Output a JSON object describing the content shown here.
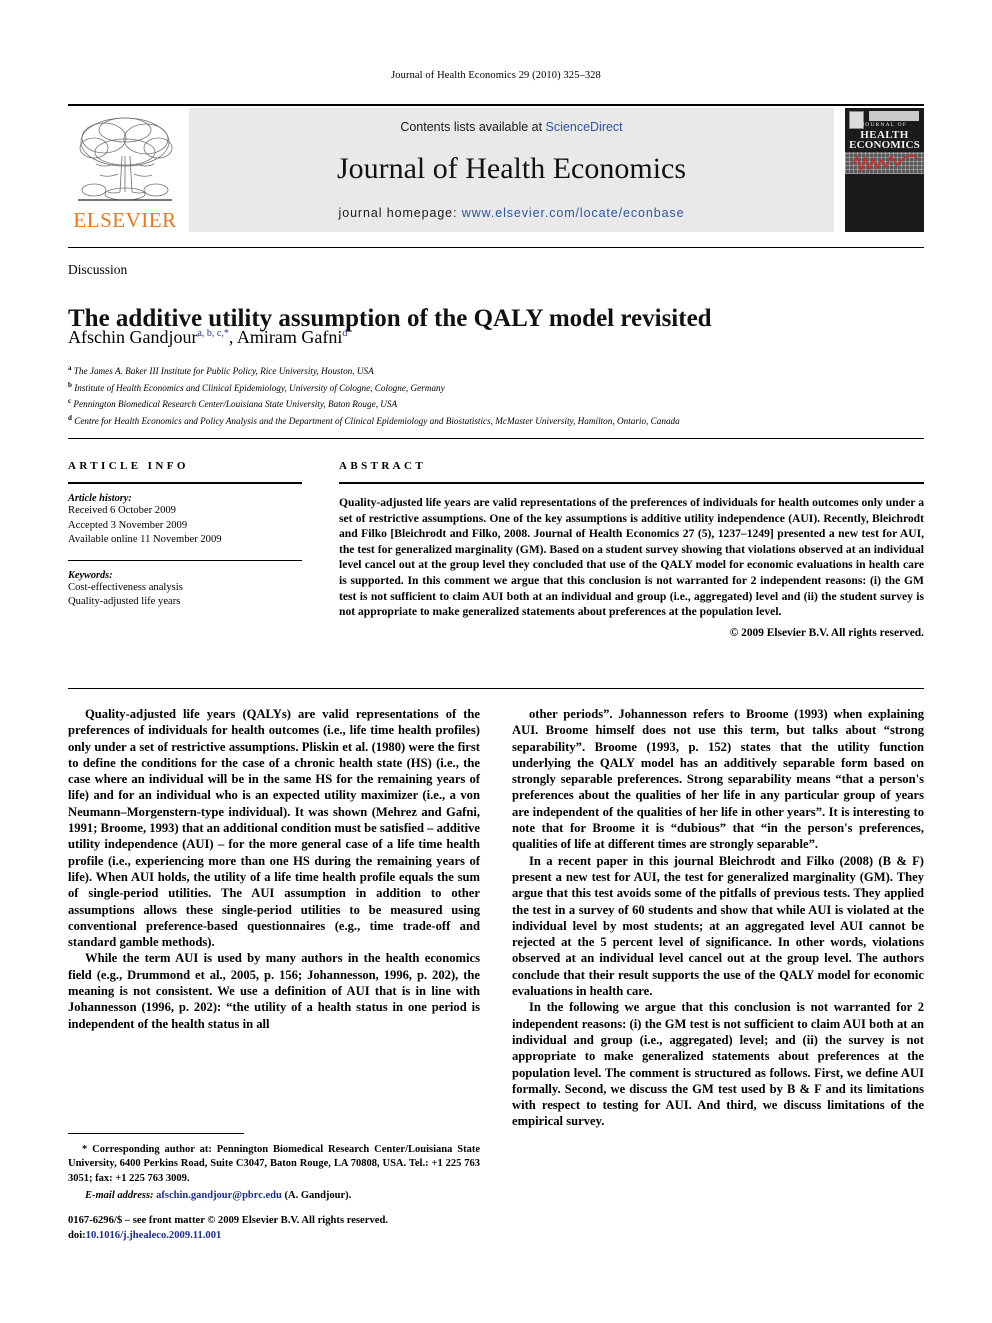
{
  "running_head": "Journal of Health Economics 29 (2010) 325–328",
  "masthead": {
    "contents_prefix": "Contents lists available at ",
    "sciencedirect": "ScienceDirect",
    "journal_title": "Journal of Health Economics",
    "homepage_prefix": "journal homepage: ",
    "homepage_url": "www.elsevier.com/locate/econbase",
    "publisher": "ELSEVIER",
    "cover": {
      "line1": "JOURNAL OF",
      "line2": "HEALTH",
      "line3": "ECONOMICS"
    },
    "link_color": "#2b55a5",
    "band_color": "#e9e9e9",
    "elsevier_orange": "#E87722"
  },
  "article": {
    "section_type": "Discussion",
    "title": "The additive utility assumption of the QALY model revisited",
    "author_1": "Afschin Gandjour",
    "author_1_sup": "a, b, c,",
    "author_1_star": "*",
    "author_2": ", Amiram Gafni",
    "author_2_sup": "d",
    "affiliations": [
      {
        "mark": "a",
        "text": "The James A. Baker III Institute for Public Policy, Rice University, Houston, USA"
      },
      {
        "mark": "b",
        "text": "Institute of Health Economics and Clinical Epidemiology, University of Cologne, Cologne, Germany"
      },
      {
        "mark": "c",
        "text": "Pennington Biomedical Research Center/Louisiana State University, Baton Rouge, USA"
      },
      {
        "mark": "d",
        "text": "Centre for Health Economics and Policy Analysis and the Department of Clinical Epidemiology and Biostatistics, McMaster University, Hamilton, Ontario, Canada"
      }
    ]
  },
  "article_info": {
    "heading": "ARTICLE INFO",
    "history_label": "Article history:",
    "history": [
      "Received 6 October 2009",
      "Accepted 3 November 2009",
      "Available online 11 November 2009"
    ],
    "keywords_label": "Keywords:",
    "keywords": [
      "Cost-effectiveness analysis",
      "Quality-adjusted life years"
    ]
  },
  "abstract": {
    "heading": "ABSTRACT",
    "text": "Quality-adjusted life years are valid representations of the preferences of individuals for health outcomes only under a set of restrictive assumptions. One of the key assumptions is additive utility independence (AUI). Recently, Bleichrodt and Filko [Bleichrodt and Filko, 2008. Journal of Health Economics 27 (5), 1237–1249] presented a new test for AUI, the test for generalized marginality (GM). Based on a student survey showing that violations observed at an individual level cancel out at the group level they concluded that use of the QALY model for economic evaluations in health care is supported. In this comment we argue that this conclusion is not warranted for 2 independent reasons: (i) the GM test is not sufficient to claim AUI both at an individual and group (i.e., aggregated) level and (ii) the student survey is not appropriate to make generalized statements about preferences at the population level.",
    "copyright": "© 2009 Elsevier B.V. All rights reserved."
  },
  "body": {
    "left": [
      "Quality-adjusted life years (QALYs) are valid representations of the preferences of individuals for health outcomes (i.e., life time health profiles) only under a set of restrictive assumptions. Pliskin et al. (1980) were the first to define the conditions for the case of a chronic health state (HS) (i.e., the case where an individual will be in the same HS for the remaining years of life) and for an individual who is an expected utility maximizer (i.e., a von Neumann–Morgenstern-type individual). It was shown (Mehrez and Gafni, 1991; Broome, 1993) that an additional condition must be satisfied – additive utility independence (AUI) – for the more general case of a life time health profile (i.e., experiencing more than one HS during the remaining years of life). When AUI holds, the utility of a life time health profile equals the sum of single-period utilities. The AUI assumption in addition to other assumptions allows these single-period utilities to be measured using conventional preference-based questionnaires (e.g., time trade-off and standard gamble methods).",
      "While the term AUI is used by many authors in the health economics field (e.g., Drummond et al., 2005, p. 156; Johannesson, 1996, p. 202), the meaning is not consistent. We use a definition of AUI that is in line with Johannesson (1996, p. 202): “the utility of a health status in one period is independent of the health status in all"
    ],
    "right": [
      "other periods”. Johannesson refers to Broome (1993) when explaining AUI. Broome himself does not use this term, but talks about “strong separability”. Broome (1993, p. 152) states that the utility function underlying the QALY model has an additively separable form based on strongly separable preferences. Strong separability means “that a person's preferences about the qualities of her life in any particular group of years are independent of the qualities of her life in other years”. It is interesting to note that for Broome it is “dubious” that “in the person's preferences, qualities of life at different times are strongly separable”.",
      "In a recent paper in this journal Bleichrodt and Filko (2008) (B & F) present a new test for AUI, the test for generalized marginality (GM). They argue that this test avoids some of the pitfalls of previous tests. They applied the test in a survey of 60 students and show that while AUI is violated at the individual level by most students; at an aggregated level AUI cannot be rejected at the 5 percent level of significance. In other words, violations observed at an individual level cancel out at the group level. The authors conclude that their result supports the use of the QALY model for economic evaluations in health care.",
      "In the following we argue that this conclusion is not warranted for 2 independent reasons: (i) the GM test is not sufficient to claim AUI both at an individual and group (i.e., aggregated) level; and (ii) the survey is not appropriate to make generalized statements about preferences at the population level. The comment is structured as follows. First, we define AUI formally. Second, we discuss the GM test used by B & F and its limitations with respect to testing for AUI. And third, we discuss limitations of the empirical survey."
    ]
  },
  "footnotes": {
    "corresponding": "* Corresponding author at: Pennington Biomedical Research Center/Louisiana State University, 6400 Perkins Road, Suite C3047, Baton Rouge, LA 70808, USA. Tel.: +1 225 763 3051; fax: +1 225 763 3009.",
    "email_label": "E-mail address:",
    "email": "afschin.gandjour@pbrc.edu",
    "email_suffix": " (A. Gandjour)."
  },
  "imprint": {
    "line1": "0167-6296/$ – see front matter © 2009 Elsevier B.V. All rights reserved.",
    "doi_label": "doi:",
    "doi": "10.1016/j.jhealeco.2009.11.001"
  }
}
